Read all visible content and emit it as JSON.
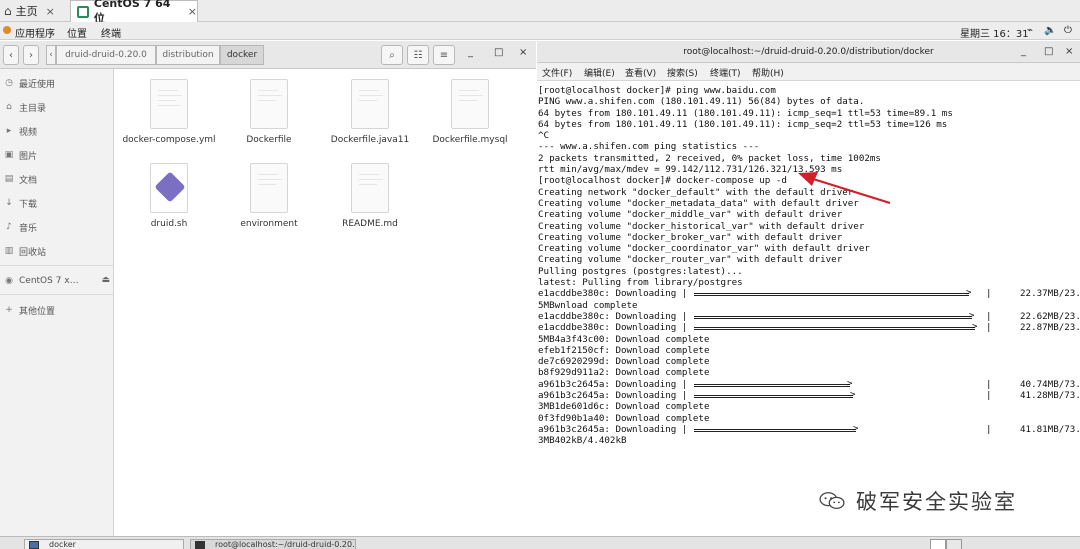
{
  "vm_tabs": {
    "home_label": "主页",
    "home_close": "×",
    "active_label": "CentOS 7 64 位",
    "active_close": "×"
  },
  "top_panel": {
    "applications": "应用程序",
    "places": "位置",
    "terminal": "终端",
    "clock": "星期三 16：31",
    "icons": [
      "network-icon",
      "volume-icon",
      "power-icon"
    ]
  },
  "file_manager": {
    "toolbar": {
      "back": "‹",
      "forward": "›",
      "breadcrumbs": [
        "druid-druid-0.20.0",
        "distribution",
        "docker"
      ],
      "search_icon": "search-icon",
      "view_icon": "view-options-icon",
      "menu_icon": "menu-icon",
      "minimize": "_",
      "maximize": "□",
      "close": "×"
    },
    "sidebar": [
      {
        "icon": "clock-icon",
        "label": "最近使用"
      },
      {
        "icon": "home-icon",
        "label": "主目录"
      },
      {
        "icon": "video-icon",
        "label": "视频"
      },
      {
        "icon": "picture-icon",
        "label": "图片"
      },
      {
        "icon": "document-icon",
        "label": "文档"
      },
      {
        "icon": "download-icon",
        "label": "下载"
      },
      {
        "icon": "music-icon",
        "label": "音乐"
      },
      {
        "icon": "trash-icon",
        "label": "回收站"
      },
      {
        "icon": "disc-icon",
        "label": "CentOS 7 x…",
        "eject": "⏏"
      },
      {
        "icon": "plus-icon",
        "label": "其他位置"
      }
    ],
    "files": [
      {
        "name": "docker-compose.yml",
        "kind": "text"
      },
      {
        "name": "Dockerfile",
        "kind": "text"
      },
      {
        "name": "Dockerfile.java11",
        "kind": "text"
      },
      {
        "name": "Dockerfile.mysql",
        "kind": "text"
      },
      {
        "name": "druid.sh",
        "kind": "script"
      },
      {
        "name": "environment",
        "kind": "text"
      },
      {
        "name": "README.md",
        "kind": "text"
      }
    ]
  },
  "terminal": {
    "title": "root@localhost:~/druid-druid-0.20.0/distribution/docker",
    "minimize": "_",
    "maximize": "□",
    "close": "×",
    "menu": [
      "文件(F)",
      "编辑(E)",
      "查看(V)",
      "搜索(S)",
      "终端(T)",
      "帮助(H)"
    ],
    "lines": [
      "[root@localhost docker]# ping www.baidu.com",
      "PING www.a.shifen.com (180.101.49.11) 56(84) bytes of data.",
      "64 bytes from 180.101.49.11 (180.101.49.11): icmp_seq=1 ttl=53 time=89.1 ms",
      "64 bytes from 180.101.49.11 (180.101.49.11): icmp_seq=2 ttl=53 time=126 ms",
      "^C",
      "--- www.a.shifen.com ping statistics ---",
      "2 packets transmitted, 2 received, 0% packet loss, time 1002ms",
      "rtt min/avg/max/mdev = 99.142/112.731/126.321/13.593 ms",
      "[root@localhost docker]# docker-compose up -d",
      "Creating network \"docker_default\" with the default driver",
      "Creating volume \"docker_metadata_data\" with default driver",
      "Creating volume \"docker_middle_var\" with default driver",
      "Creating volume \"docker_historical_var\" with default driver",
      "Creating volume \"docker_broker_var\" with default driver",
      "Creating volume \"docker_coordinator_var\" with default driver",
      "Creating volume \"docker_router_var\" with default driver",
      "Pulling postgres (postgres:latest)...",
      "latest: Pulling from library/postgres"
    ],
    "progress_1": {
      "id": "e1acddbe380c:",
      "status": "Downloading",
      "size": "22.37MB/23.1",
      "fill": 0.97
    },
    "line_wrap_1": "5MBwnload complete",
    "progress_2": {
      "id": "e1acddbe380c:",
      "status": "Downloading",
      "size": "22.62MB/23.1",
      "fill": 0.98
    },
    "progress_3": {
      "id": "e1acddbe380c:",
      "status": "Downloading",
      "size": "22.87MB/23.1",
      "fill": 0.99
    },
    "lines_2": [
      "5MB4a3f43c00: Download complete",
      "efeb1f2150cf: Download complete",
      "de7c6920299d: Download complete",
      "b8f929d911a2: Download complete"
    ],
    "progress_4": {
      "id": "a961b3c2645a:",
      "status": "Downloading",
      "size": "40.74MB/73.8",
      "fill": 0.55
    },
    "progress_5": {
      "id": "a961b3c2645a:",
      "status": "Downloading",
      "size": "41.28MB/73.8",
      "fill": 0.56
    },
    "lines_3": [
      "3MB1de601d6c: Download complete",
      "0f3fd90b1a40: Download complete"
    ],
    "progress_6": {
      "id": "a961b3c2645a:",
      "status": "Downloading",
      "size": "41.81MB/73.8",
      "fill": 0.57
    },
    "last_line": "3MB402kB/4.402kB"
  },
  "watermark": {
    "text": "破军安全实验室",
    "icon": "wechat-icon"
  },
  "taskbar": {
    "task1": "docker",
    "task2": "root@localhost:~/druid-druid-0.20..."
  },
  "colors": {
    "arrow": "#d0202a",
    "folder_green": "#2e8b57"
  }
}
